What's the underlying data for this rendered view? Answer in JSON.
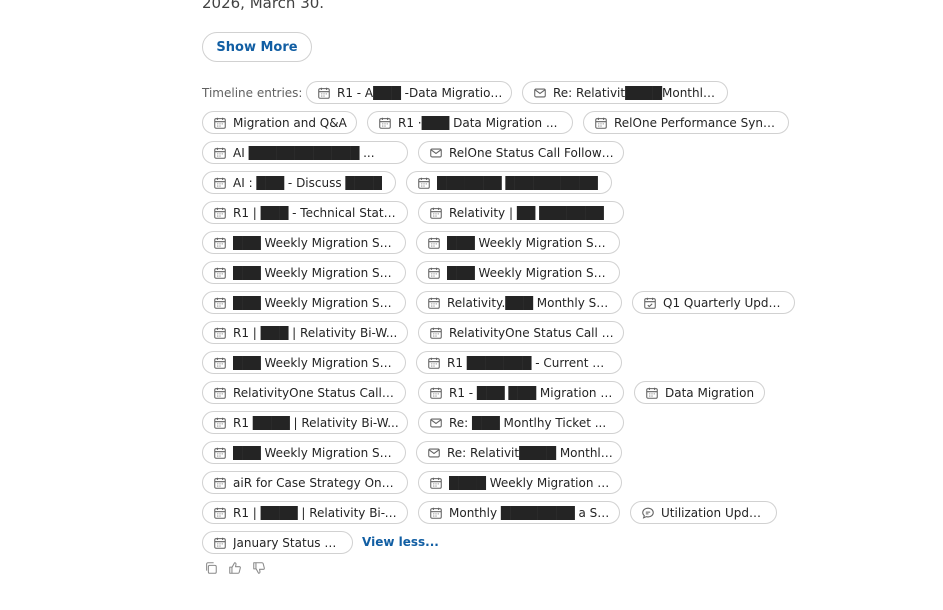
{
  "summary_tail": "2026, March 30.",
  "show_more_label": "Show More",
  "timeline_label": "Timeline entries:",
  "view_less_label": "View less...",
  "entries": [
    {
      "icon": "calendar-icon",
      "label": "R1 - A███ -Data Migration ..."
    },
    {
      "icon": "mail-icon",
      "label": "Re: Relativit████Monthly ..."
    },
    {
      "icon": "calendar-icon",
      "label": "Migration and Q&A"
    },
    {
      "icon": "calendar-icon",
      "label": "R1 ·███ Data Migration ..."
    },
    {
      "icon": "calendar-icon",
      "label": "RelOne Performance Sync ..."
    },
    {
      "icon": "calendar-icon",
      "label": "AI ████████████ ..."
    },
    {
      "icon": "mail-icon",
      "label": "RelOne Status Call Follow ..."
    },
    {
      "icon": "calendar-icon",
      "label": "AI : ███ - Discuss ████"
    },
    {
      "icon": "calendar-icon",
      "label": "███████ ██████████"
    },
    {
      "icon": "calendar-icon",
      "label": "R1 | ███ - Technical Statu..."
    },
    {
      "icon": "calendar-icon",
      "label": "Relativity | ██ ███████"
    },
    {
      "icon": "calendar-icon",
      "label": "███ Weekly Migration Sync"
    },
    {
      "icon": "calendar-icon",
      "label": "███ Weekly Migration Sync"
    },
    {
      "icon": "calendar-icon",
      "label": "███ Weekly Migration Sync"
    },
    {
      "icon": "calendar-icon",
      "label": "███ Weekly Migration Sync"
    },
    {
      "icon": "calendar-icon",
      "label": "███ Weekly Migration Sync"
    },
    {
      "icon": "calendar-icon",
      "label": "Relativity.███ Monthly Suc..."
    },
    {
      "icon": "calendar-check-icon",
      "label": "Q1 Quarterly Update"
    },
    {
      "icon": "calendar-icon",
      "label": "R1 | ███ | Relativity Bi-W..."
    },
    {
      "icon": "calendar-icon",
      "label": "RelativityOne Status Call | ..."
    },
    {
      "icon": "calendar-icon",
      "label": "███ Weekly Migration Sync"
    },
    {
      "icon": "calendar-icon",
      "label": "R1 ███████ - Current Mi..."
    },
    {
      "icon": "calendar-icon",
      "label": "RelativityOne Status Call | ..."
    },
    {
      "icon": "calendar-icon",
      "label": "R1 - ███ ███ Migration P..."
    },
    {
      "icon": "calendar-icon",
      "label": "Data Migration"
    },
    {
      "icon": "calendar-icon",
      "label": "R1 ████ | Relativity Bi-W..."
    },
    {
      "icon": "mail-icon",
      "label": "Re: ███ Montlhy Ticket ..."
    },
    {
      "icon": "calendar-icon",
      "label": "███ Weekly Migration Sync"
    },
    {
      "icon": "mail-icon",
      "label": "Re: Relativit████ Monthly ..."
    },
    {
      "icon": "calendar-icon",
      "label": "aiR for Case Strategy Onb..."
    },
    {
      "icon": "calendar-icon",
      "label": "████ Weekly Migration Sync"
    },
    {
      "icon": "calendar-icon",
      "label": "R1 | ████ | Relativity Bi-W..."
    },
    {
      "icon": "calendar-icon",
      "label": "Monthly ████████ a Sync"
    },
    {
      "icon": "chat-icon",
      "label": "Utilization Update"
    },
    {
      "icon": "calendar-icon",
      "label": "January Status Call"
    }
  ]
}
